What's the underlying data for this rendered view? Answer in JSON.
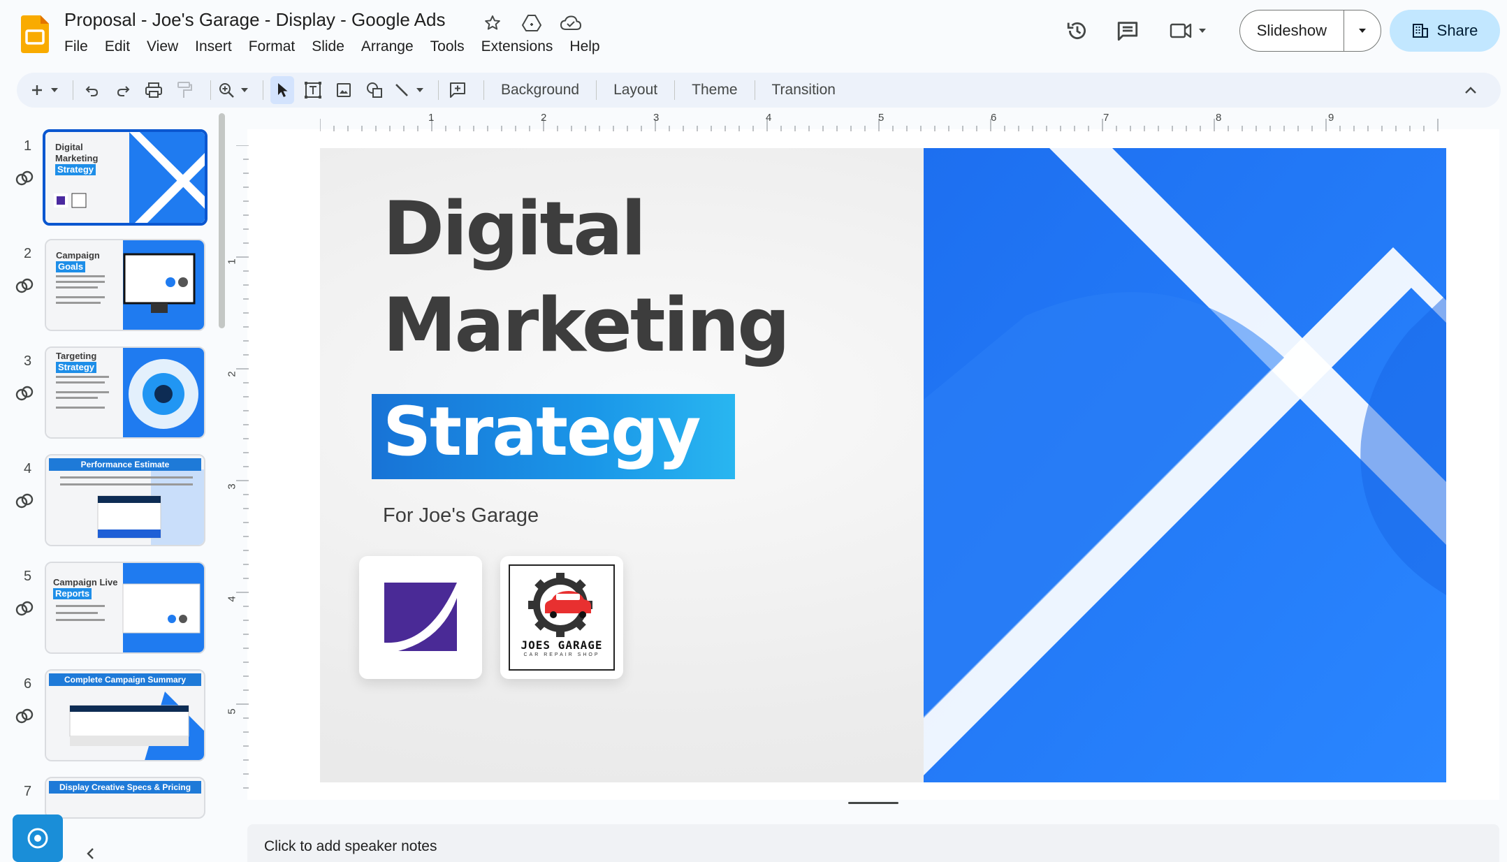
{
  "document": {
    "title": "Proposal - Joe's Garage - Display - Google Ads"
  },
  "menu": [
    "File",
    "Edit",
    "View",
    "Insert",
    "Format",
    "Slide",
    "Arrange",
    "Tools",
    "Extensions",
    "Help"
  ],
  "header": {
    "slideshow_label": "Slideshow",
    "share_label": "Share"
  },
  "toolbar": {
    "background_label": "Background",
    "layout_label": "Layout",
    "theme_label": "Theme",
    "transition_label": "Transition"
  },
  "filmstrip": {
    "slides": [
      {
        "number": "1",
        "title_line1": "Digital",
        "title_line2": "Marketing",
        "highlight": "Strategy"
      },
      {
        "number": "2",
        "title_line1": "Campaign",
        "highlight": "Goals"
      },
      {
        "number": "3",
        "title_line1": "Targeting",
        "highlight": "Strategy"
      },
      {
        "number": "4",
        "banner": "Performance Estimate"
      },
      {
        "number": "5",
        "title_line1": "Campaign Live",
        "highlight": "Reports"
      },
      {
        "number": "6",
        "banner": "Complete Campaign Summary"
      },
      {
        "number": "7",
        "banner": "Display Creative Specs & Pricing"
      }
    ]
  },
  "rulers": {
    "horizontal": [
      "1",
      "2",
      "3",
      "4",
      "5",
      "6",
      "7",
      "8",
      "9"
    ],
    "vertical": [
      "1",
      "2",
      "3",
      "4",
      "5"
    ]
  },
  "slide": {
    "title_line1": "Digital",
    "title_line2": "Marketing",
    "title_highlight": "Strategy",
    "subtitle": "For Joe's Garage",
    "client_logo_text": "JOES GARAGE",
    "client_logo_subtext": "CAR REPAIR SHOP"
  },
  "speaker_notes": {
    "placeholder": "Click to add speaker notes"
  },
  "colors": {
    "accent_blue": "#1a73e8",
    "slide_blue": "#1f7bf0",
    "share_bg": "#c2e7ff",
    "slides_yellow": "#f9ab00"
  }
}
